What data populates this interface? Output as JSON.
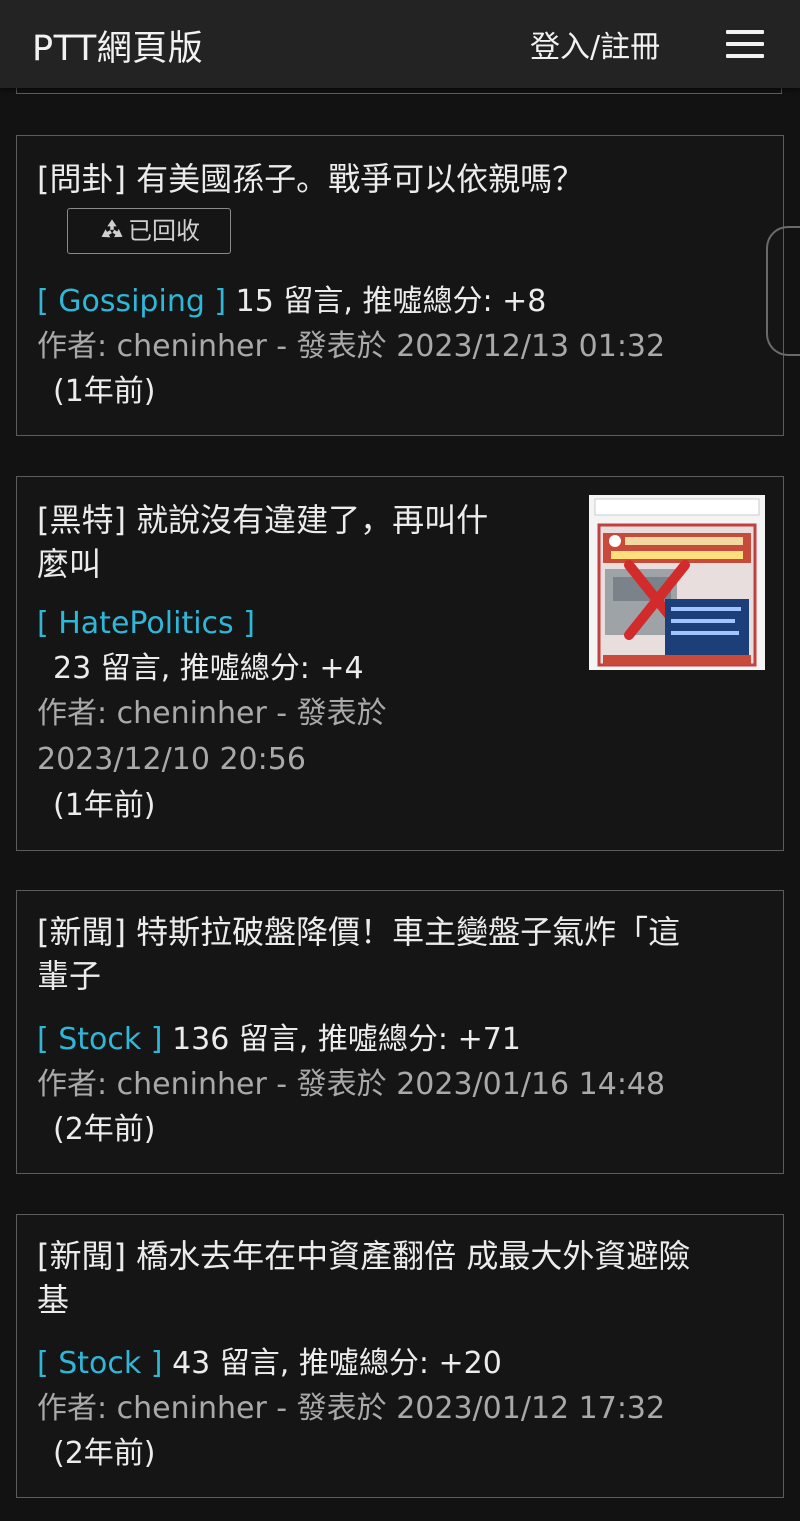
{
  "header": {
    "title": "PTT網頁版",
    "login_label": "登入/註冊"
  },
  "posts": [
    {
      "title": "[問卦] 有美國孫子。戰爭可以依親嗎？",
      "badge": "已回收",
      "board": "[ Gossiping ]",
      "stats": "15 留言, 推噓總分: +8",
      "author_line": "作者: cheninher - 發表於 2023/12/13 01:32",
      "ago": "(1年前)"
    },
    {
      "title_line1": "[黑特] 就說沒有違建了，再叫什",
      "title_line2": "麼叫",
      "board": "[ HatePolitics ]",
      "stats": "23 留言, 推噓總分: +4",
      "author_line1": "作者: cheninher - 發表於",
      "author_line2": "2023/12/10 20:56",
      "ago": "(1年前)"
    },
    {
      "title_line1": "[新聞] 特斯拉破盤降價！車主變盤子氣炸「這",
      "title_line2": "輩子",
      "board": "[ Stock ]",
      "stats": "136 留言, 推噓總分: +71",
      "author_line": "作者: cheninher - 發表於 2023/01/16 14:48",
      "ago": "(2年前)"
    },
    {
      "title_line1": "[新聞] 橋水去年在中資產翻倍 成最大外資避險",
      "title_line2": "基",
      "board": "[ Stock ]",
      "stats": "43 留言, 推噓總分: +20",
      "author_line": "作者: cheninher - 發表於 2023/01/12 17:32",
      "ago": "(2年前)"
    }
  ],
  "colors": {
    "board_link": "#2fb7d8",
    "background": "#121212",
    "header": "#232323"
  }
}
